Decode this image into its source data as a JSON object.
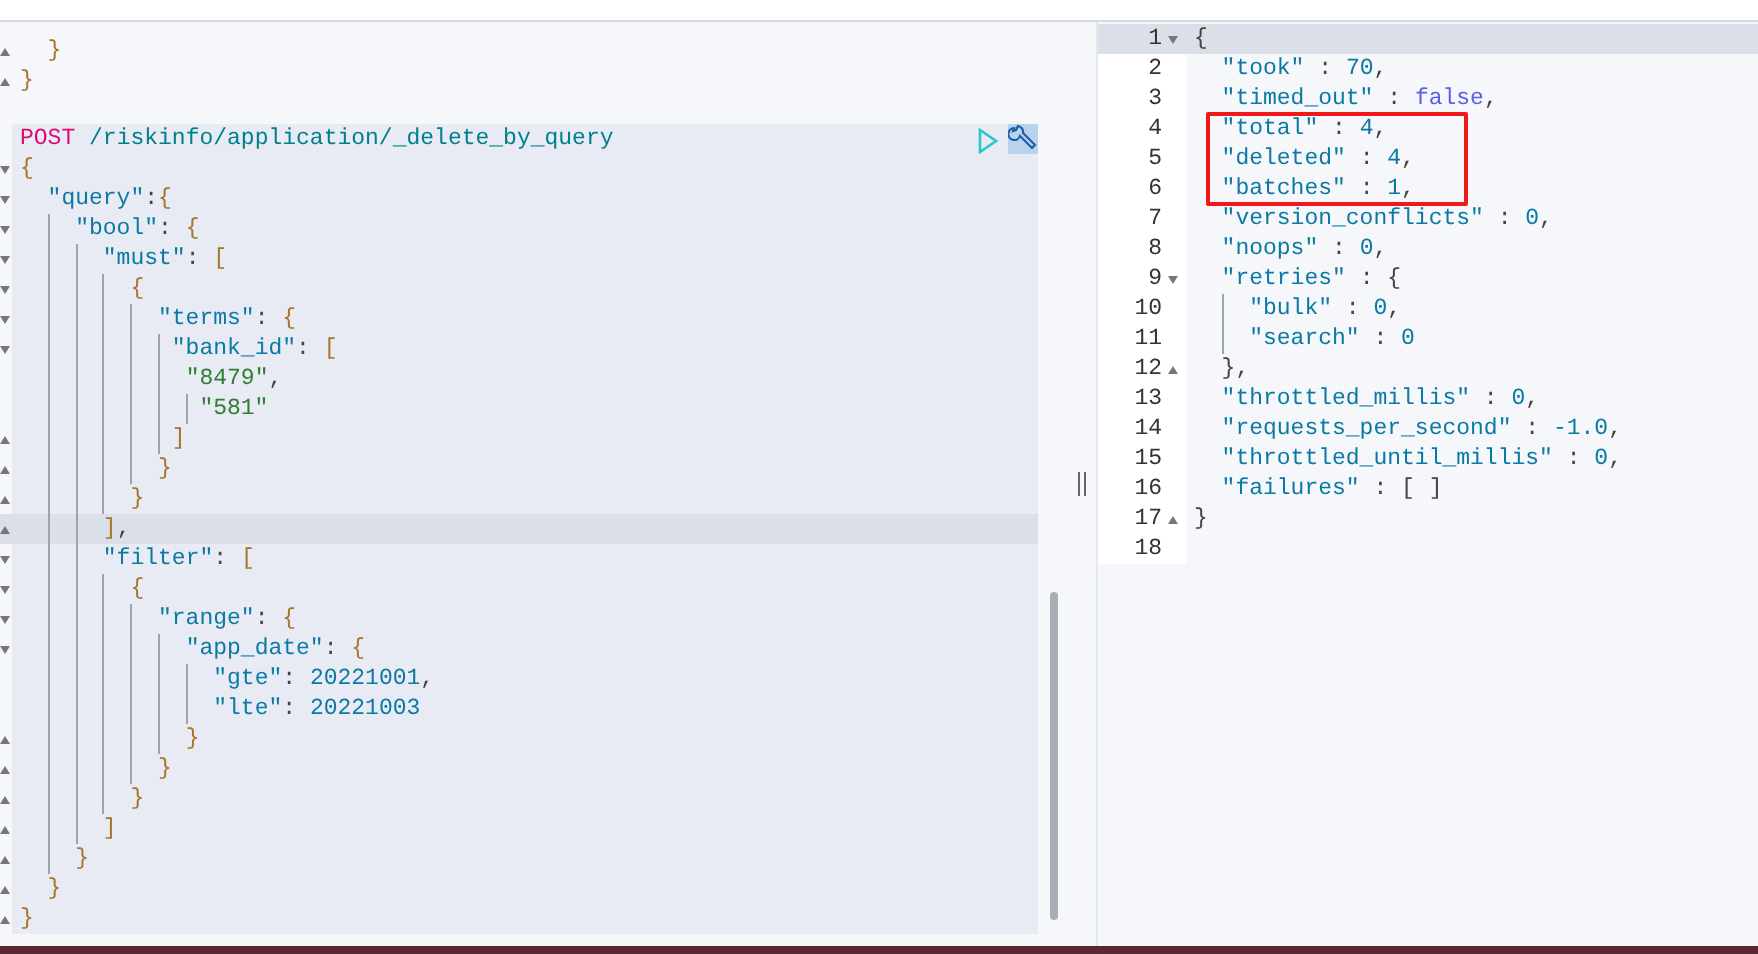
{
  "request_editor": {
    "lines_above": [
      {
        "kind": "close",
        "active": false,
        "segs": [
          {
            "text": "  }",
            "kind": "brace"
          }
        ]
      },
      {
        "kind": "close",
        "active": false,
        "segs": [
          {
            "text": "}",
            "kind": "brace"
          }
        ]
      }
    ],
    "actions": [
      {
        "kind": "run"
      },
      {
        "kind": "settings"
      }
    ],
    "lines": [
      {
        "kind": "plain",
        "active": false,
        "segs": [
          {
            "text": "POST",
            "kind": "method"
          },
          {
            "text": " /riskinfo/application/_delete_by_query",
            "kind": "url"
          }
        ]
      },
      {
        "kind": "open",
        "active": false,
        "segs": [
          {
            "text": "{",
            "kind": "brace"
          }
        ]
      },
      {
        "kind": "open",
        "active": false,
        "segs": [
          {
            "text": "  \"query\"",
            "kind": "key"
          },
          {
            "text": ":",
            "kind": "punct"
          },
          {
            "text": "{",
            "kind": "brace"
          }
        ]
      },
      {
        "kind": "open",
        "active": false,
        "segs": [
          {
            "text": "    \"bool\"",
            "kind": "key"
          },
          {
            "text": ": ",
            "kind": "punct"
          },
          {
            "text": "{",
            "kind": "brace"
          }
        ]
      },
      {
        "kind": "open",
        "active": false,
        "segs": [
          {
            "text": "      \"must\"",
            "kind": "key"
          },
          {
            "text": ": ",
            "kind": "punct"
          },
          {
            "text": "[",
            "kind": "brace"
          }
        ]
      },
      {
        "kind": "open",
        "active": false,
        "segs": [
          {
            "text": "        {",
            "kind": "brace"
          }
        ]
      },
      {
        "kind": "open",
        "active": false,
        "segs": [
          {
            "text": "          \"terms\"",
            "kind": "key"
          },
          {
            "text": ": ",
            "kind": "punct"
          },
          {
            "text": "{",
            "kind": "brace"
          }
        ]
      },
      {
        "kind": "open",
        "active": false,
        "segs": [
          {
            "text": "           \"bank_id\"",
            "kind": "key"
          },
          {
            "text": ": ",
            "kind": "punct"
          },
          {
            "text": "[",
            "kind": "brace"
          }
        ]
      },
      {
        "kind": "plain",
        "active": false,
        "segs": [
          {
            "text": "            \"8479\"",
            "kind": "string"
          },
          {
            "text": ",",
            "kind": "punct"
          }
        ]
      },
      {
        "kind": "plain",
        "active": false,
        "segs": [
          {
            "text": "             \"581\"",
            "kind": "string"
          }
        ]
      },
      {
        "kind": "close",
        "active": false,
        "segs": [
          {
            "text": "           ]",
            "kind": "brace"
          }
        ]
      },
      {
        "kind": "close",
        "active": false,
        "segs": [
          {
            "text": "          }",
            "kind": "brace"
          }
        ]
      },
      {
        "kind": "close",
        "active": false,
        "segs": [
          {
            "text": "        }",
            "kind": "brace"
          }
        ]
      },
      {
        "kind": "close",
        "active": true,
        "segs": [
          {
            "text": "      ]",
            "kind": "brace"
          },
          {
            "text": ",",
            "kind": "punct"
          }
        ]
      },
      {
        "kind": "open",
        "active": false,
        "segs": [
          {
            "text": "      \"filter\"",
            "kind": "key"
          },
          {
            "text": ": ",
            "kind": "punct"
          },
          {
            "text": "[",
            "kind": "brace"
          }
        ]
      },
      {
        "kind": "open",
        "active": false,
        "segs": [
          {
            "text": "        {",
            "kind": "brace"
          }
        ]
      },
      {
        "kind": "open",
        "active": false,
        "segs": [
          {
            "text": "          \"range\"",
            "kind": "key"
          },
          {
            "text": ": ",
            "kind": "punct"
          },
          {
            "text": "{",
            "kind": "brace"
          }
        ]
      },
      {
        "kind": "open",
        "active": false,
        "segs": [
          {
            "text": "            \"app_date\"",
            "kind": "key"
          },
          {
            "text": ": ",
            "kind": "punct"
          },
          {
            "text": "{",
            "kind": "brace"
          }
        ]
      },
      {
        "kind": "plain",
        "active": false,
        "segs": [
          {
            "text": "              \"gte\"",
            "kind": "key"
          },
          {
            "text": ": ",
            "kind": "punct"
          },
          {
            "text": "20221001",
            "kind": "number"
          },
          {
            "text": ",",
            "kind": "punct"
          }
        ]
      },
      {
        "kind": "plain",
        "active": false,
        "segs": [
          {
            "text": "              \"lte\"",
            "kind": "key"
          },
          {
            "text": ": ",
            "kind": "punct"
          },
          {
            "text": "20221003",
            "kind": "number"
          }
        ]
      },
      {
        "kind": "close",
        "active": false,
        "segs": [
          {
            "text": "            }",
            "kind": "brace"
          }
        ]
      },
      {
        "kind": "close",
        "active": false,
        "segs": [
          {
            "text": "          }",
            "kind": "brace"
          }
        ]
      },
      {
        "kind": "close",
        "active": false,
        "segs": [
          {
            "text": "        }",
            "kind": "brace"
          }
        ]
      },
      {
        "kind": "close",
        "active": false,
        "segs": [
          {
            "text": "      ]",
            "kind": "brace"
          }
        ]
      },
      {
        "kind": "close",
        "active": false,
        "segs": [
          {
            "text": "    }",
            "kind": "brace"
          }
        ]
      },
      {
        "kind": "close",
        "active": false,
        "segs": [
          {
            "text": "  }",
            "kind": "brace"
          }
        ]
      },
      {
        "kind": "close",
        "active": false,
        "segs": [
          {
            "text": "}",
            "kind": "brace"
          }
        ]
      }
    ]
  },
  "response": {
    "lines": [
      {
        "number": "1",
        "kind": "open",
        "active": true,
        "boxed": false,
        "segs": [
          {
            "text": "{",
            "kind": "punct"
          }
        ]
      },
      {
        "number": "2",
        "kind": "plain",
        "active": false,
        "boxed": false,
        "segs": [
          {
            "text": "  \"took\"",
            "kind": "key"
          },
          {
            "text": " : ",
            "kind": "punct"
          },
          {
            "text": "70",
            "kind": "number"
          },
          {
            "text": ",",
            "kind": "punct"
          }
        ]
      },
      {
        "number": "3",
        "kind": "plain",
        "active": false,
        "boxed": false,
        "segs": [
          {
            "text": "  \"timed_out\"",
            "kind": "key"
          },
          {
            "text": " : ",
            "kind": "punct"
          },
          {
            "text": "false",
            "kind": "bool"
          },
          {
            "text": ",",
            "kind": "punct"
          }
        ]
      },
      {
        "number": "4",
        "kind": "plain",
        "active": false,
        "boxed": true,
        "segs": [
          {
            "text": "  \"total\"",
            "kind": "key"
          },
          {
            "text": " : ",
            "kind": "punct"
          },
          {
            "text": "4",
            "kind": "number"
          },
          {
            "text": ",",
            "kind": "punct"
          }
        ]
      },
      {
        "number": "5",
        "kind": "plain",
        "active": false,
        "boxed": true,
        "segs": [
          {
            "text": "  \"deleted\"",
            "kind": "key"
          },
          {
            "text": " : ",
            "kind": "punct"
          },
          {
            "text": "4",
            "kind": "number"
          },
          {
            "text": ",",
            "kind": "punct"
          }
        ]
      },
      {
        "number": "6",
        "kind": "plain",
        "active": false,
        "boxed": true,
        "segs": [
          {
            "text": "  \"batches\"",
            "kind": "key"
          },
          {
            "text": " : ",
            "kind": "punct"
          },
          {
            "text": "1",
            "kind": "number"
          },
          {
            "text": ",",
            "kind": "punct"
          }
        ]
      },
      {
        "number": "7",
        "kind": "plain",
        "active": false,
        "boxed": false,
        "segs": [
          {
            "text": "  \"version_conflicts\"",
            "kind": "key"
          },
          {
            "text": " : ",
            "kind": "punct"
          },
          {
            "text": "0",
            "kind": "number"
          },
          {
            "text": ",",
            "kind": "punct"
          }
        ]
      },
      {
        "number": "8",
        "kind": "plain",
        "active": false,
        "boxed": false,
        "segs": [
          {
            "text": "  \"noops\"",
            "kind": "key"
          },
          {
            "text": " : ",
            "kind": "punct"
          },
          {
            "text": "0",
            "kind": "number"
          },
          {
            "text": ",",
            "kind": "punct"
          }
        ]
      },
      {
        "number": "9",
        "kind": "open",
        "active": false,
        "boxed": false,
        "segs": [
          {
            "text": "  \"retries\"",
            "kind": "key"
          },
          {
            "text": " : ",
            "kind": "punct"
          },
          {
            "text": "{",
            "kind": "punct"
          }
        ]
      },
      {
        "number": "10",
        "kind": "plain",
        "active": false,
        "boxed": false,
        "segs": [
          {
            "text": "    \"bulk\"",
            "kind": "key"
          },
          {
            "text": " : ",
            "kind": "punct"
          },
          {
            "text": "0",
            "kind": "number"
          },
          {
            "text": ",",
            "kind": "punct"
          }
        ]
      },
      {
        "number": "11",
        "kind": "plain",
        "active": false,
        "boxed": false,
        "segs": [
          {
            "text": "    \"search\"",
            "kind": "key"
          },
          {
            "text": " : ",
            "kind": "punct"
          },
          {
            "text": "0",
            "kind": "number"
          }
        ]
      },
      {
        "number": "12",
        "kind": "close",
        "active": false,
        "boxed": false,
        "segs": [
          {
            "text": "  }",
            "kind": "punct"
          },
          {
            "text": ",",
            "kind": "punct"
          }
        ]
      },
      {
        "number": "13",
        "kind": "plain",
        "active": false,
        "boxed": false,
        "segs": [
          {
            "text": "  \"throttled_millis\"",
            "kind": "key"
          },
          {
            "text": " : ",
            "kind": "punct"
          },
          {
            "text": "0",
            "kind": "number"
          },
          {
            "text": ",",
            "kind": "punct"
          }
        ]
      },
      {
        "number": "14",
        "kind": "plain",
        "active": false,
        "boxed": false,
        "segs": [
          {
            "text": "  \"requests_per_second\"",
            "kind": "key"
          },
          {
            "text": " : ",
            "kind": "punct"
          },
          {
            "text": "-1.0",
            "kind": "number"
          },
          {
            "text": ",",
            "kind": "punct"
          }
        ]
      },
      {
        "number": "15",
        "kind": "plain",
        "active": false,
        "boxed": false,
        "segs": [
          {
            "text": "  \"throttled_until_millis\"",
            "kind": "key"
          },
          {
            "text": " : ",
            "kind": "punct"
          },
          {
            "text": "0",
            "kind": "number"
          },
          {
            "text": ",",
            "kind": "punct"
          }
        ]
      },
      {
        "number": "16",
        "kind": "plain",
        "active": false,
        "boxed": false,
        "segs": [
          {
            "text": "  \"failures\"",
            "kind": "key"
          },
          {
            "text": " : ",
            "kind": "punct"
          },
          {
            "text": "[ ]",
            "kind": "punct"
          }
        ]
      },
      {
        "number": "17",
        "kind": "close",
        "active": false,
        "boxed": false,
        "segs": [
          {
            "text": "}",
            "kind": "punct"
          }
        ]
      },
      {
        "number": "18",
        "kind": "plain",
        "active": false,
        "boxed": false
      }
    ]
  }
}
